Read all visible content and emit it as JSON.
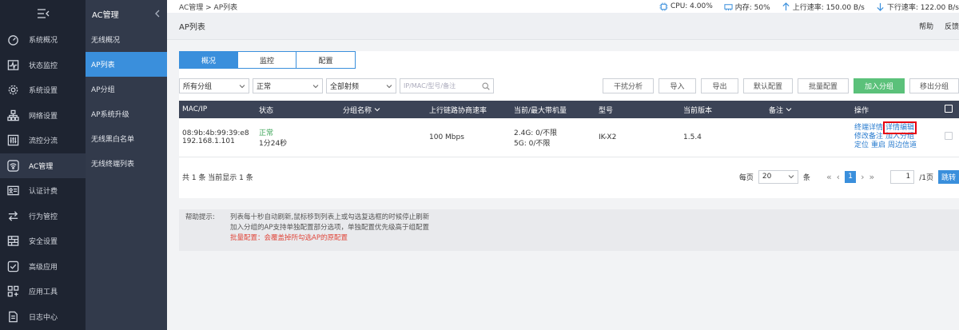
{
  "nav_primary": {
    "toggle_icon": "menu-collapse-icon",
    "items": [
      {
        "label": "系统概况",
        "icon": "dashboard-icon"
      },
      {
        "label": "状态监控",
        "icon": "monitor-icon"
      },
      {
        "label": "系统设置",
        "icon": "gear-icon"
      },
      {
        "label": "网络设置",
        "icon": "network-icon"
      },
      {
        "label": "流控分流",
        "icon": "sliders-icon"
      },
      {
        "label": "AC管理",
        "icon": "wifi-icon"
      },
      {
        "label": "认证计费",
        "icon": "id-card-icon"
      },
      {
        "label": "行为管控",
        "icon": "swap-icon"
      },
      {
        "label": "安全设置",
        "icon": "firewall-icon"
      },
      {
        "label": "高级应用",
        "icon": "check-box-icon"
      },
      {
        "label": "应用工具",
        "icon": "apps-icon"
      },
      {
        "label": "日志中心",
        "icon": "log-icon"
      }
    ],
    "active_index": 5
  },
  "nav_secondary": {
    "title": "AC管理",
    "items": [
      "无线概况",
      "AP列表",
      "AP分组",
      "AP系统升级",
      "无线黑白名单",
      "无线终端列表"
    ],
    "active_index": 1
  },
  "topbar": {
    "breadcrumb": "AC管理 > AP列表",
    "cpu": "CPU: 4.00%",
    "memory": "内存: 50%",
    "upload": "上行速率: 150.00 B/s",
    "download": "下行速率: 122.00 B/s"
  },
  "titlebar": {
    "title": "AP列表",
    "help": "帮助",
    "feedback": "反馈"
  },
  "tabs": [
    "概况",
    "监控",
    "配置"
  ],
  "filters": {
    "group": "所有分组",
    "status": "正常",
    "freq": "全部射频",
    "search_placeholder": "IP/MAC/型号/备注"
  },
  "actions": [
    "干扰分析",
    "导入",
    "导出",
    "默认配置",
    "批量配置",
    "加入分组",
    "移出分组"
  ],
  "table": {
    "headers": [
      "MAC/IP",
      "状态",
      "分组名称",
      "上行链路协商速率",
      "当前/最大带机量",
      "型号",
      "当前版本",
      "备注",
      "操作"
    ],
    "row": {
      "mac": "08:9b:4b:99:39:e8",
      "ip": "192.168.1.101",
      "status": "正常",
      "uptime": "1分24秒",
      "group": "",
      "rate": "100 Mbps",
      "load_24": "2.4G: 0/不限",
      "load_5": "5G: 0/不限",
      "model": "IK-X2",
      "version": "1.5.4",
      "remark": "",
      "ops": [
        "终端详情",
        "详情编辑",
        "修改备注",
        "加入分组",
        "定位",
        "重启",
        "周边信道"
      ]
    }
  },
  "pager": {
    "summary": "共 1 条 当前显示 1 条",
    "per_page_label": "每页",
    "per_page": "20",
    "unit": "条",
    "current": "1",
    "goto_value": "1",
    "total_pages": "/1页",
    "jump": "跳转"
  },
  "help": {
    "label": "帮助提示:",
    "lines": [
      "列表每十秒自动刷新,鼠标移到列表上或勾选复选框的时候停止刷新",
      "加入分组的AP支持单独配置部分选项，单独配置优先级高于组配置"
    ],
    "warning": "批量配置：会覆盖掉所勾选AP的原配置"
  }
}
